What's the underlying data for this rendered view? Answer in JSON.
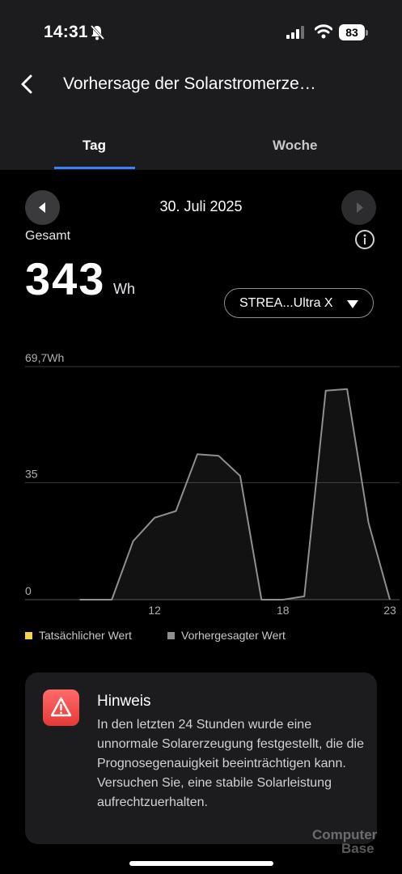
{
  "status": {
    "time": "14:31",
    "battery": "83"
  },
  "header": {
    "title": "Vorhersage der Solarstromerze…"
  },
  "tabs": [
    {
      "label": "Tag"
    },
    {
      "label": "Woche"
    }
  ],
  "date": "30. Juli 2025",
  "summary": {
    "label": "Gesamt",
    "value": "343",
    "unit": "Wh"
  },
  "device_select": {
    "selected": "STREA...Ultra X"
  },
  "chart_data": {
    "type": "area",
    "ylim": [
      0,
      69.7
    ],
    "ytick_labels": [
      "69,7Wh",
      "35",
      "0"
    ],
    "yticks": [
      69.7,
      35,
      0
    ],
    "xticks": [
      12,
      18,
      23
    ],
    "xlim": [
      7.8,
      23
    ],
    "series": [
      {
        "name": "Vorhergesagter Wert",
        "color": "#8e8e93",
        "x": [
          8.5,
          9,
          10,
          11,
          12,
          13,
          14,
          15,
          16,
          17,
          18,
          19,
          20,
          21,
          22,
          23
        ],
        "y": [
          0,
          0,
          0,
          17.5,
          24.5,
          26.5,
          43.5,
          43,
          37,
          0,
          0,
          1,
          62.5,
          63,
          23,
          0
        ]
      }
    ],
    "legend": [
      {
        "label": "Tatsächlicher Wert",
        "color": "#f5d547"
      },
      {
        "label": "Vorhergesagter Wert",
        "color": "#8e8e93"
      }
    ],
    "grid": true
  },
  "notice": {
    "title": "Hinweis",
    "body": "In den letzten 24 Stunden wurde eine unnormale Solarerzeugung festgestellt, die die Prognosegenauigkeit beeinträchtigen kann. Versuchen Sie, eine stabile Solarleistung aufrechtzuerhalten."
  },
  "watermark": {
    "line1": "Computer",
    "line2": "Base"
  }
}
